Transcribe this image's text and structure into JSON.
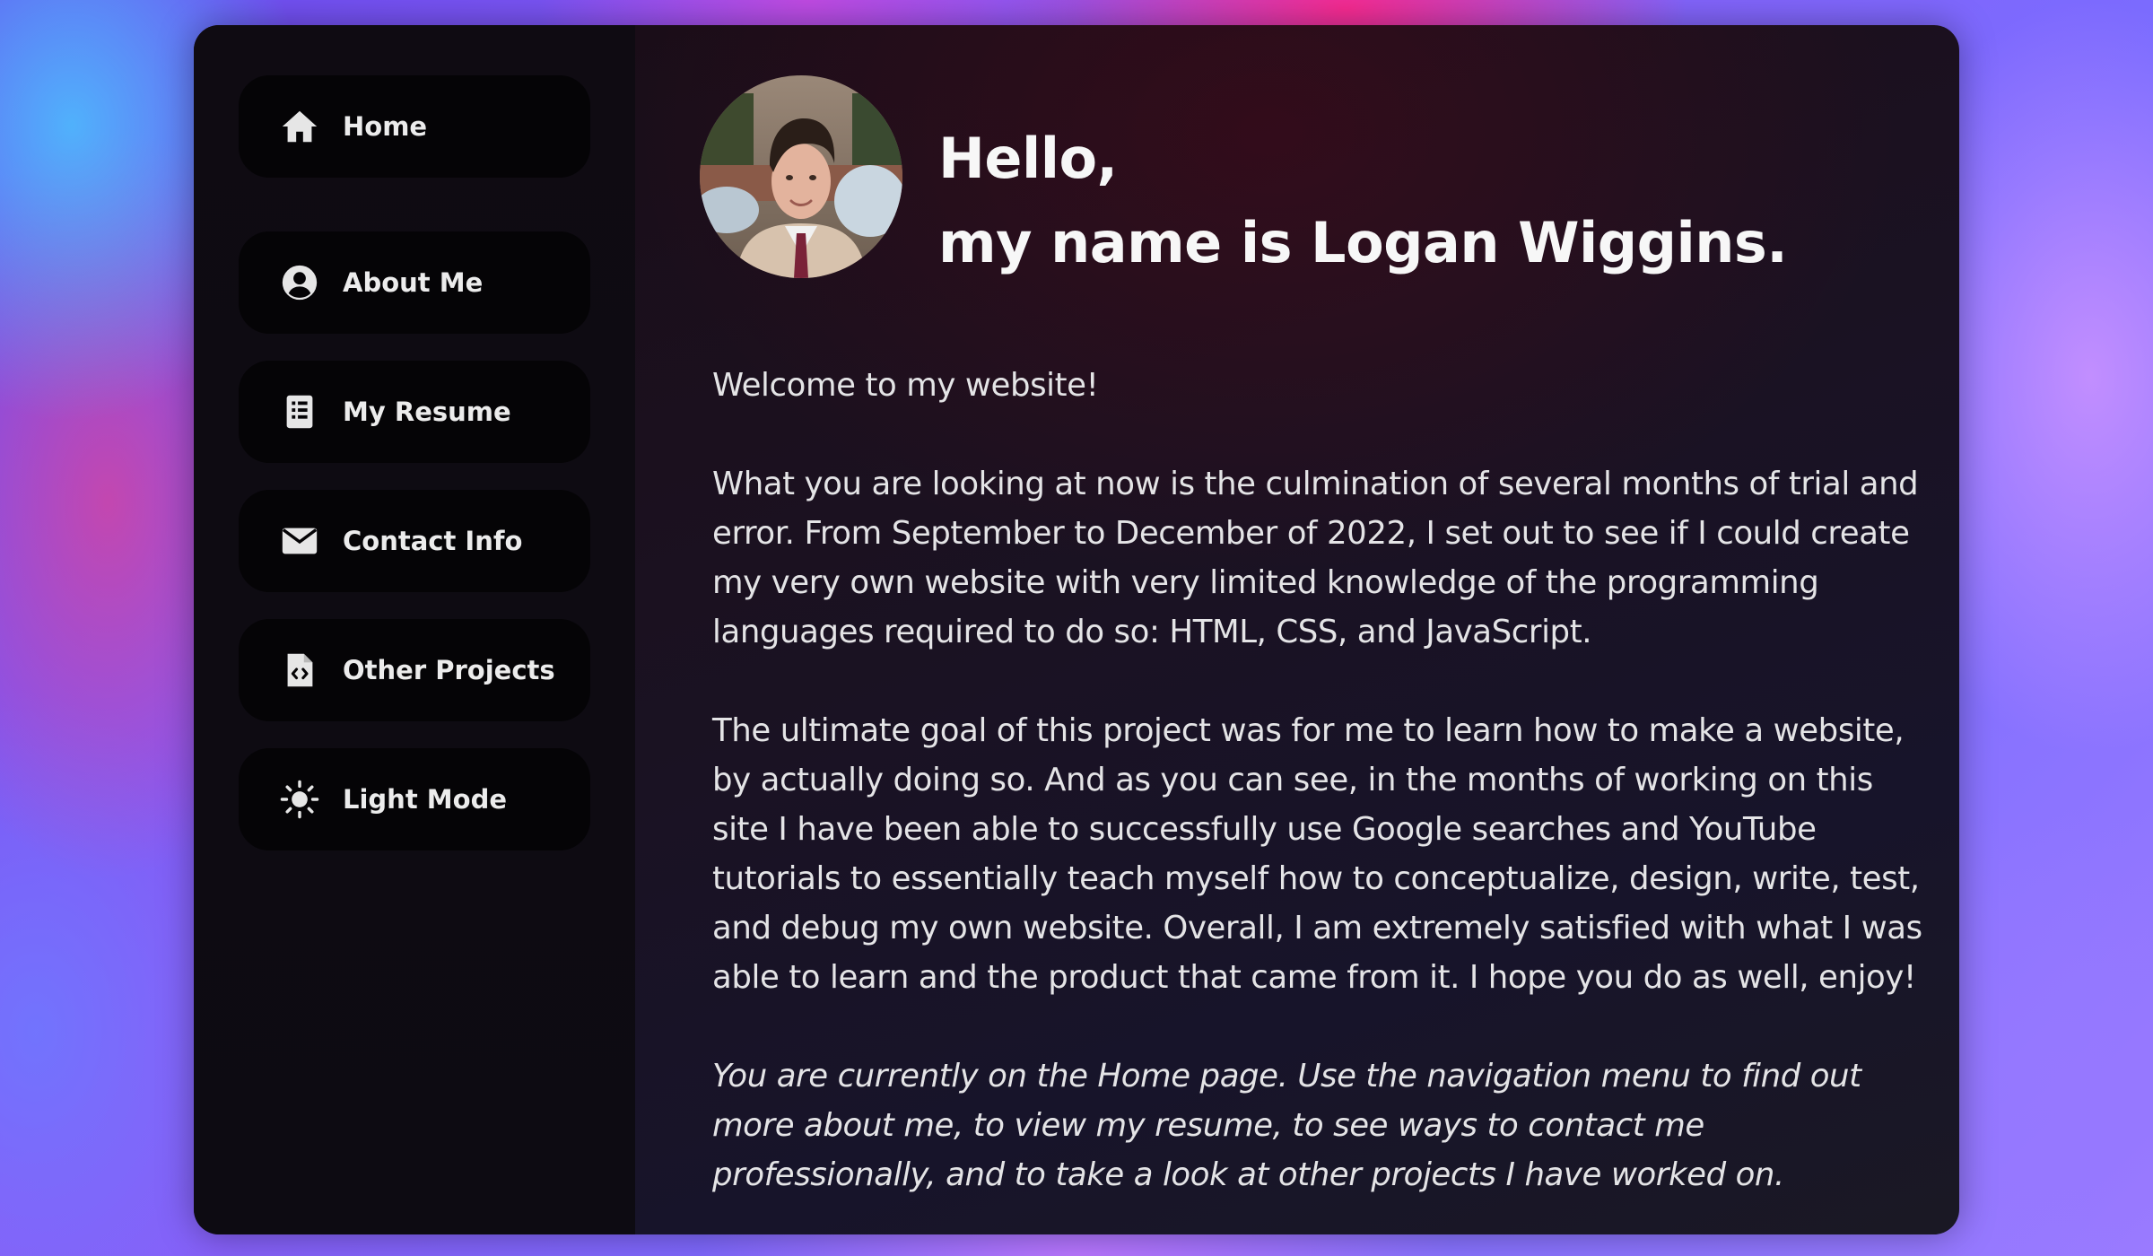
{
  "sidebar": {
    "items": [
      {
        "icon": "home-icon",
        "label": "Home"
      },
      {
        "icon": "user-circle-icon",
        "label": "About Me"
      },
      {
        "icon": "document-icon",
        "label": "My Resume"
      },
      {
        "icon": "envelope-icon",
        "label": "Contact Info"
      },
      {
        "icon": "code-file-icon",
        "label": "Other Projects"
      },
      {
        "icon": "sun-icon",
        "label": "Light Mode"
      }
    ]
  },
  "header": {
    "greeting_line1": "Hello,",
    "greeting_line2": "my name is Logan Wiggins."
  },
  "content": {
    "welcome": "Welcome to my website!",
    "paragraph1": "What you are looking at now is the culmination of several months of trial and error. From September to December of 2022, I set out to see if I could create my very own website with very limited knowledge of the programming languages required to do so: HTML, CSS, and JavaScript.",
    "paragraph2": "The ultimate goal of this project was for me to learn how to make a website, by actually doing so. And as you can see, in the months of working on this site I have been able to successfully use Google searches and YouTube tutorials to essentially teach myself how to conceptualize, design, write, test, and debug my own website. Overall, I am extremely satisfied with what I was able to learn and the product that came from it. I hope you do as well, enjoy!",
    "note": "You are currently on the Home page. Use the navigation menu to find out more about me, to view my resume, to see ways to contact me professionally, and to take a look at other projects I have worked on."
  },
  "colors": {
    "window_bg": "#1a1120",
    "sidebar_bg": "#0f0b12",
    "nav_button_bg": "#050406",
    "text": "#e4e4e6",
    "heading": "#f7f7f7"
  }
}
